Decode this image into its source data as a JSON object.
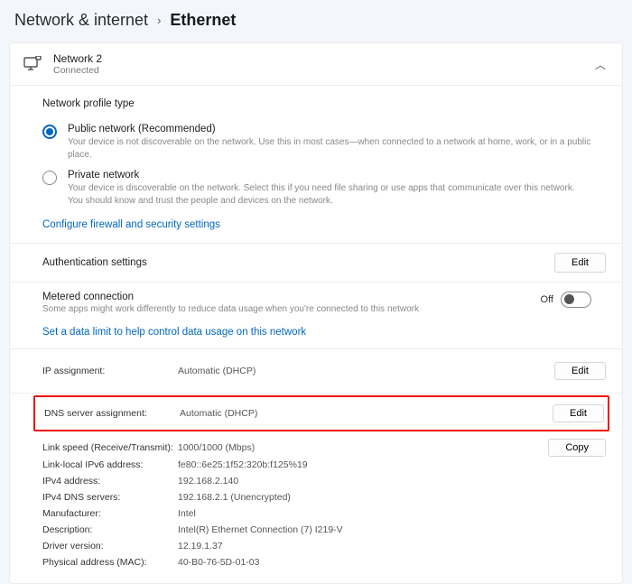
{
  "breadcrumb": {
    "parent": "Network & internet",
    "current": "Ethernet"
  },
  "network": {
    "name": "Network 2",
    "status": "Connected"
  },
  "profile": {
    "title": "Network profile type",
    "public": {
      "label": "Public network (Recommended)",
      "desc": "Your device is not discoverable on the network. Use this in most cases—when connected to a network at home, work, or in a public place."
    },
    "private": {
      "label": "Private network",
      "desc": "Your device is discoverable on the network. Select this if you need file sharing or use apps that communicate over this network. You should know and trust the people and devices on the network."
    },
    "firewall_link": "Configure firewall and security settings"
  },
  "auth": {
    "label": "Authentication settings",
    "edit": "Edit"
  },
  "metered": {
    "label": "Metered connection",
    "desc": "Some apps might work differently to reduce data usage when you're connected to this network",
    "toggle_text": "Off",
    "link": "Set a data limit to help control data usage on this network"
  },
  "ip": {
    "label": "IP assignment:",
    "value": "Automatic (DHCP)",
    "edit": "Edit"
  },
  "dns": {
    "label": "DNS server assignment:",
    "value": "Automatic (DHCP)",
    "edit": "Edit"
  },
  "details": {
    "copy": "Copy",
    "rows": [
      {
        "k": "Link speed (Receive/Transmit):",
        "v": "1000/1000 (Mbps)"
      },
      {
        "k": "Link-local IPv6 address:",
        "v": "fe80::6e25:1f52:320b:f125%19"
      },
      {
        "k": "IPv4 address:",
        "v": "192.168.2.140"
      },
      {
        "k": "IPv4 DNS servers:",
        "v": "192.168.2.1 (Unencrypted)"
      },
      {
        "k": "Manufacturer:",
        "v": "Intel"
      },
      {
        "k": "Description:",
        "v": "Intel(R) Ethernet Connection (7) I219-V"
      },
      {
        "k": "Driver version:",
        "v": "12.19.1.37"
      },
      {
        "k": "Physical address (MAC):",
        "v": "40-B0-76-5D-01-03"
      }
    ]
  }
}
